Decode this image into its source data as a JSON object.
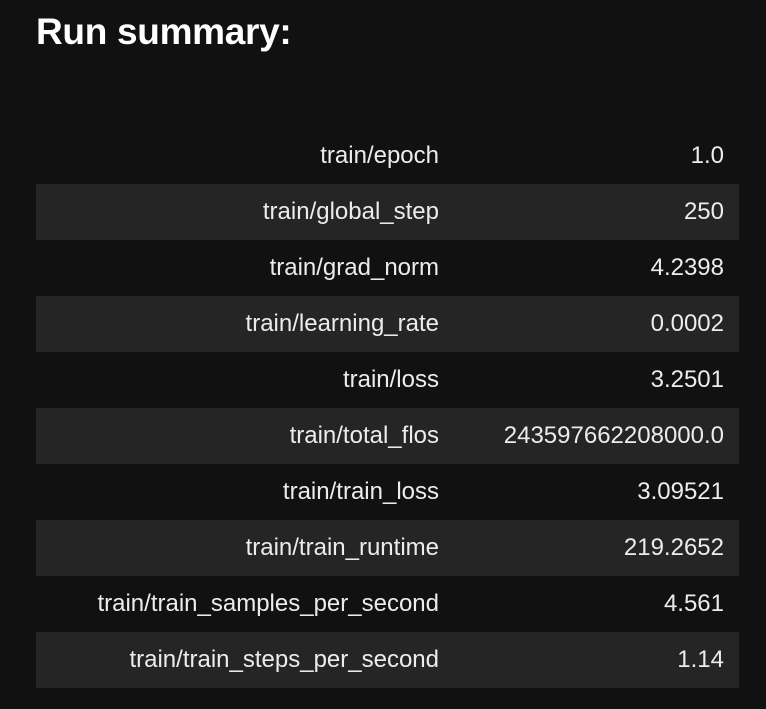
{
  "title": "Run summary:",
  "rows": [
    {
      "key": "train/epoch",
      "value": "1.0"
    },
    {
      "key": "train/global_step",
      "value": "250"
    },
    {
      "key": "train/grad_norm",
      "value": "4.2398"
    },
    {
      "key": "train/learning_rate",
      "value": "0.0002"
    },
    {
      "key": "train/loss",
      "value": "3.2501"
    },
    {
      "key": "train/total_flos",
      "value": "243597662208000.0"
    },
    {
      "key": "train/train_loss",
      "value": "3.09521"
    },
    {
      "key": "train/train_runtime",
      "value": "219.2652"
    },
    {
      "key": "train/train_samples_per_second",
      "value": "4.561"
    },
    {
      "key": "train/train_steps_per_second",
      "value": "1.14"
    }
  ],
  "colors": {
    "background": "#111111",
    "striped_row": "#252525",
    "text": "#ececec"
  }
}
